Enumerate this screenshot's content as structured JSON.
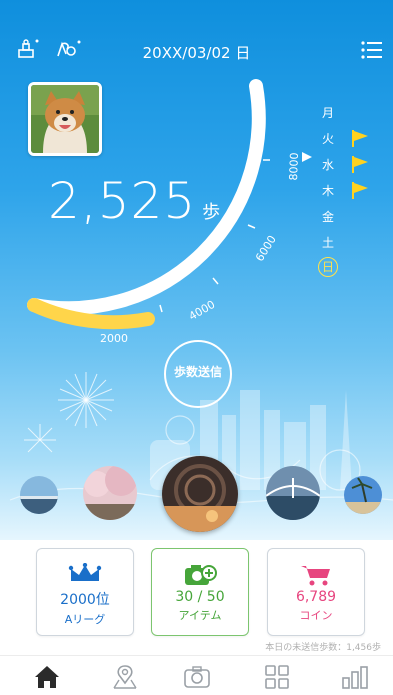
{
  "header": {
    "date": "20XX/03/02 日"
  },
  "steps": {
    "value": "2,525",
    "unit": "歩"
  },
  "dial": {
    "labels": [
      "2000",
      "4000",
      "6000",
      "8000"
    ],
    "progress": 0.31
  },
  "week": [
    {
      "label": "月",
      "flag": false,
      "today": false
    },
    {
      "label": "火",
      "flag": true,
      "today": false
    },
    {
      "label": "水",
      "flag": true,
      "today": false
    },
    {
      "label": "木",
      "flag": true,
      "today": false
    },
    {
      "label": "金",
      "flag": false,
      "today": false
    },
    {
      "label": "土",
      "flag": false,
      "today": false
    },
    {
      "label": "日",
      "flag": false,
      "today": true
    }
  ],
  "send_button": {
    "label": "歩数送信"
  },
  "cards": {
    "rank": {
      "value": "2000位",
      "sub": "Aリーグ",
      "color": "#1a6fc9"
    },
    "items": {
      "value": "30 / 50",
      "sub": "アイテム",
      "color": "#46a53a"
    },
    "coins": {
      "value": "6,789",
      "sub": "コイン",
      "color": "#e7457f"
    }
  },
  "unsent": "本日の未送信歩数：1,456歩",
  "icons": {
    "top_left": [
      "stamp-icon",
      "map-pin-person-icon"
    ],
    "top_right": "list-menu-icon",
    "tabs": [
      "home-icon",
      "map-pin-icon",
      "camera-icon",
      "grid-icon",
      "bar-chart-icon"
    ]
  },
  "colors": {
    "accent": "#1585d8",
    "progress": "#ffd54a",
    "flag": "#ffd21f"
  }
}
